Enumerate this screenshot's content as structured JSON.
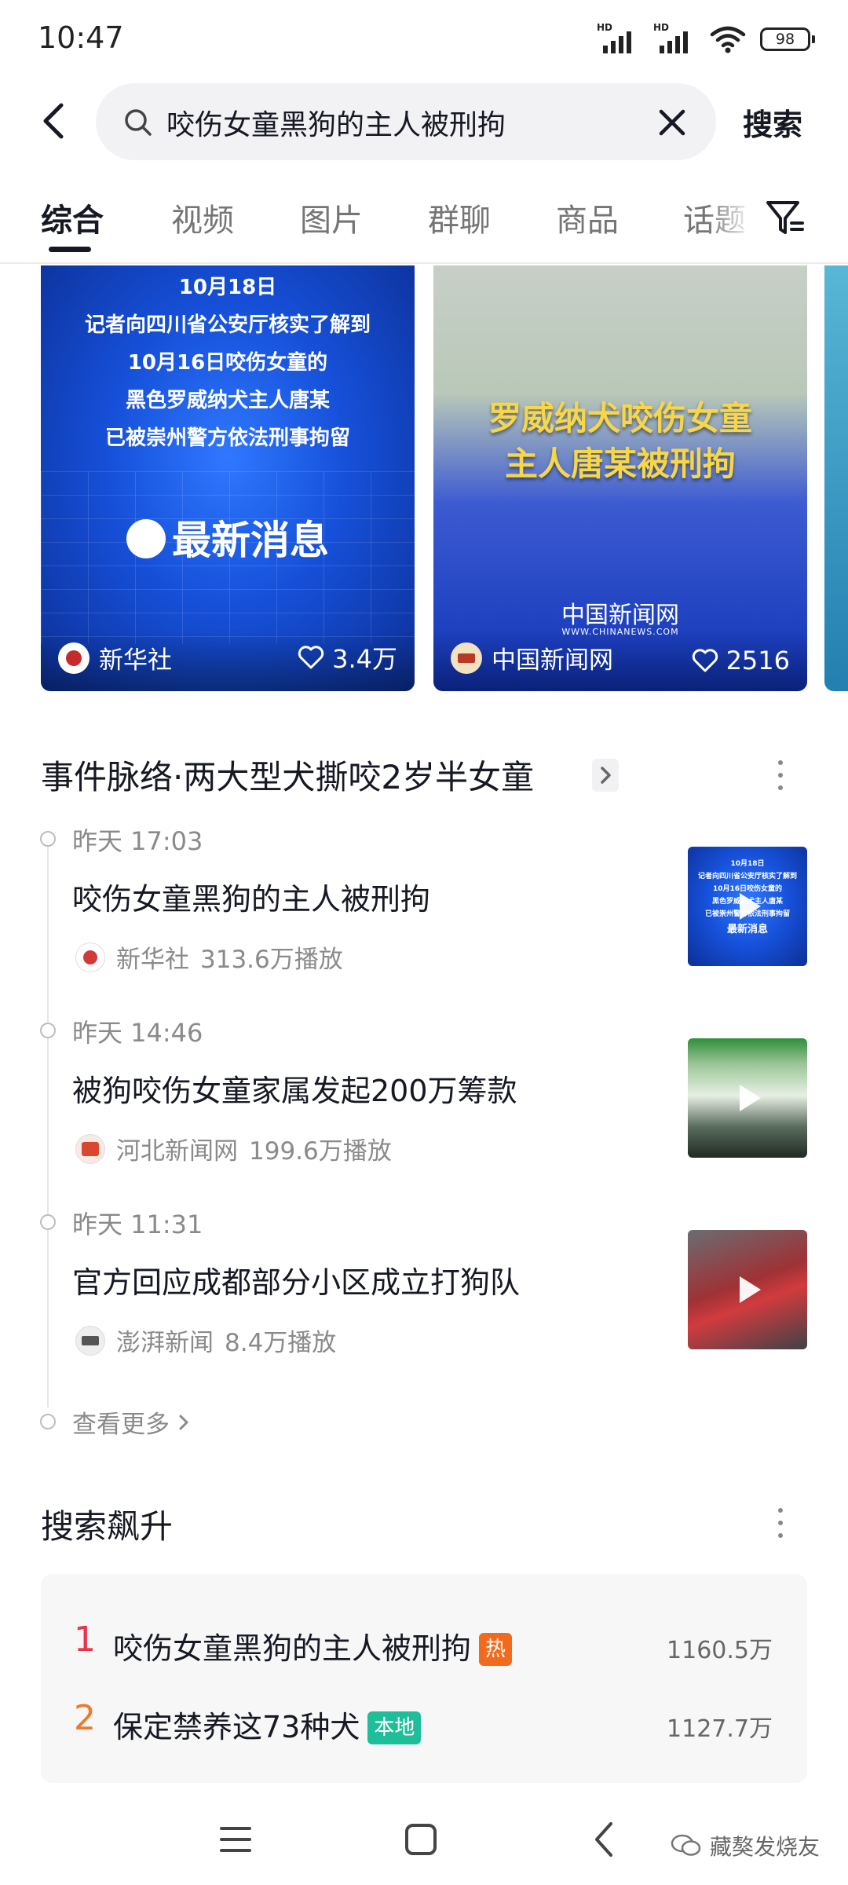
{
  "status_bar": {
    "time": "10:47",
    "network_label": "HD",
    "battery": "98"
  },
  "search": {
    "query": "咬伤女童黑狗的主人被刑拘",
    "submit_label": "搜索"
  },
  "tabs": [
    {
      "label": "综合"
    },
    {
      "label": "视频"
    },
    {
      "label": "图片"
    },
    {
      "label": "群聊"
    },
    {
      "label": "商品"
    },
    {
      "label": "话题"
    }
  ],
  "video_cards": [
    {
      "lines": [
        "10月18日",
        "记者向四川省公安厅核实了解到",
        "10月16日咬伤女童的",
        "黑色罗威纳犬主人唐某",
        "已被崇州警方依法刑事拘留"
      ],
      "banner": "最新消息",
      "source": "新华社",
      "likes": "3.4万"
    },
    {
      "headline_1": "罗威纳犬咬伤女童",
      "headline_2": "主人唐某被刑拘",
      "logo": "中国新闻网",
      "logo_sub": "WWW.CHINANEWS.COM",
      "source": "中国新闻网",
      "likes": "2516"
    }
  ],
  "event": {
    "title": "事件脉络·两大型犬撕咬2岁半女童",
    "items": [
      {
        "time": "昨天 17:03",
        "headline": "咬伤女童黑狗的主人被刑拘",
        "source": "新华社",
        "plays": "313.6万播放",
        "thumb_lines": [
          "10月18日",
          "记者向四川省公安厅核实了解到",
          "10月16日咬伤女童的",
          "黑色罗威纳犬主人唐某",
          "已被崇州警方依法刑事拘留",
          "最新消息"
        ]
      },
      {
        "time": "昨天 14:46",
        "headline": "被狗咬伤女童家属发起200万筹款",
        "source": "河北新闻网",
        "plays": "199.6万播放"
      },
      {
        "time": "昨天 11:31",
        "headline": "官方回应成都部分小区成立打狗队",
        "source": "澎湃新闻",
        "plays": "8.4万播放"
      }
    ],
    "see_more": "查看更多"
  },
  "trending": {
    "title": "搜索飙升",
    "items": [
      {
        "rank": "1",
        "text": "咬伤女童黑狗的主人被刑拘",
        "tag": "热",
        "count": "1160.5万",
        "rank_color": "#e8334a",
        "tag_color": "#f26b1d"
      },
      {
        "rank": "2",
        "text": "保定禁养这73种犬",
        "tag": "本地",
        "count": "1127.7万",
        "rank_color": "#f0772e",
        "tag_color": "#1ebe9a"
      }
    ]
  },
  "watermark": {
    "text": "藏獒发烧友"
  },
  "colors": {
    "accent": "#161823",
    "muted": "#8a8a8a",
    "card_blue": "#1650d9"
  }
}
